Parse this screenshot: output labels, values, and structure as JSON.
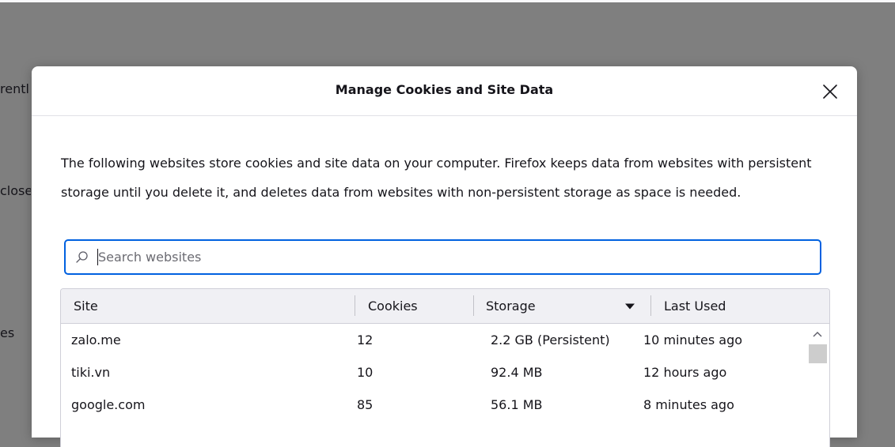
{
  "background": {
    "fragments": [
      "rentl",
      "close",
      "es"
    ]
  },
  "dialog": {
    "title": "Manage Cookies and Site Data",
    "description": "The following websites store cookies and site data on your computer. Firefox keeps data from websites with persistent storage until you delete it, and deletes data from websites with non-persistent storage as space is needed.",
    "search": {
      "placeholder": "Search websites",
      "value": "",
      "icon": "search-icon"
    },
    "table": {
      "columns": [
        "Site",
        "Cookies",
        "Storage",
        "Last Used"
      ],
      "sorted_column": "Storage",
      "rows": [
        {
          "site": "zalo.me",
          "cookies": "12",
          "storage": "2.2 GB (Persistent)",
          "last_used": "10 minutes ago"
        },
        {
          "site": "tiki.vn",
          "cookies": "10",
          "storage": "92.4 MB",
          "last_used": "12 hours ago"
        },
        {
          "site": "google.com",
          "cookies": "85",
          "storage": "56.1 MB",
          "last_used": "8 minutes ago"
        }
      ]
    }
  },
  "colors": {
    "overlay": "#7f7f7f",
    "accent": "#0061e0",
    "header_bg": "#f0f0f4",
    "text": "#15141a"
  }
}
